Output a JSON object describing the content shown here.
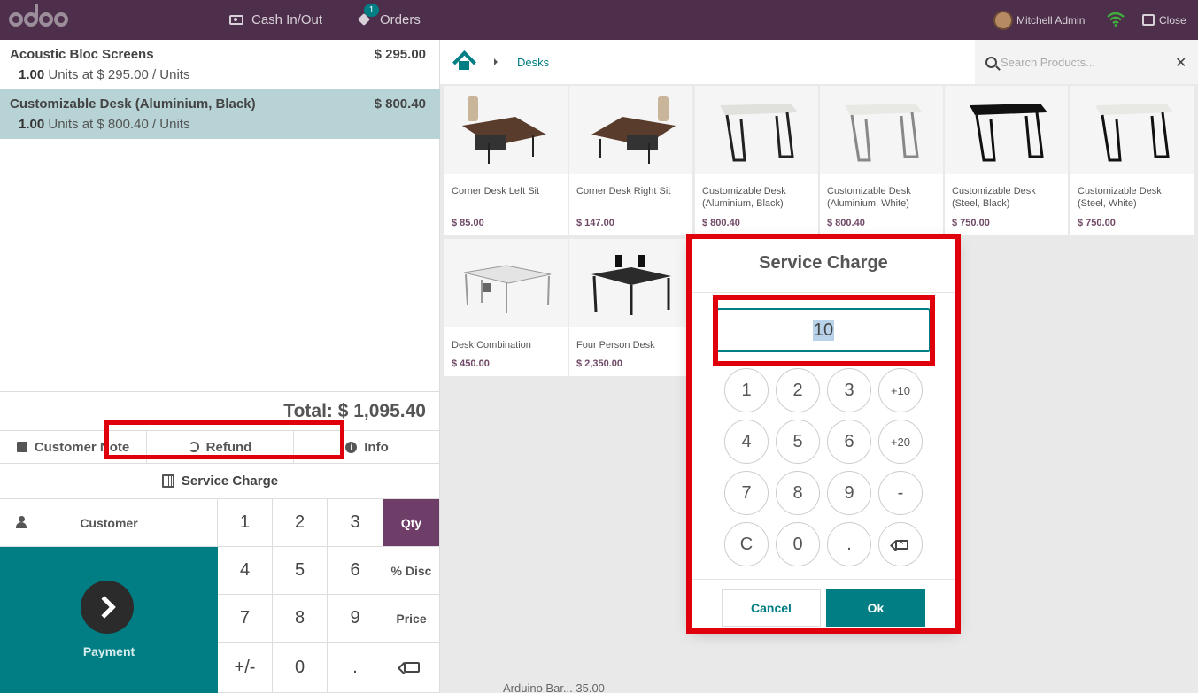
{
  "header": {
    "cash_label": "Cash In/Out",
    "orders_label": "Orders",
    "orders_badge": "1",
    "user_name": "Mitchell Admin",
    "close_label": "Close"
  },
  "order": {
    "lines": [
      {
        "name": "Acoustic Bloc Screens",
        "price": "$ 295.00",
        "qty": "1.00",
        "unit_text": "Units at $ 295.00 / Units"
      },
      {
        "name": "Customizable Desk (Aluminium, Black)",
        "price": "$ 800.40",
        "qty": "1.00",
        "unit_text": "Units at $ 800.40 / Units"
      }
    ],
    "total": "Total: $ 1,095.40"
  },
  "controls": {
    "customer_note": "Customer Note",
    "refund": "Refund",
    "info": "Info",
    "service_charge": "Service Charge"
  },
  "numpad": {
    "customer": "Customer",
    "payment": "Payment",
    "keys": [
      "1",
      "2",
      "3",
      "Qty",
      "4",
      "5",
      "6",
      "% Disc",
      "7",
      "8",
      "9",
      "Price",
      "+/-",
      "0",
      "."
    ]
  },
  "breadcrumb": {
    "category": "Desks"
  },
  "search": {
    "placeholder": "Search Products..."
  },
  "products": [
    {
      "name": "Corner Desk Left Sit",
      "price": "$ 85.00"
    },
    {
      "name": "Corner Desk Right Sit",
      "price": "$ 147.00"
    },
    {
      "name": "Customizable Desk (Aluminium, Black)",
      "price": "$ 800.40"
    },
    {
      "name": "Customizable Desk (Aluminium, White)",
      "price": "$ 800.40"
    },
    {
      "name": "Customizable Desk (Steel, Black)",
      "price": "$ 750.00"
    },
    {
      "name": "Customizable Desk (Steel, White)",
      "price": "$ 750.00"
    },
    {
      "name": "Desk Combination",
      "price": "$ 450.00"
    },
    {
      "name": "Four Person Desk",
      "price": "$ 2,350.00"
    }
  ],
  "modal": {
    "title": "Service Charge",
    "value": "10",
    "keys": [
      "1",
      "2",
      "3",
      "+10",
      "4",
      "5",
      "6",
      "+20",
      "7",
      "8",
      "9",
      "-",
      "C",
      "0",
      "."
    ],
    "cancel": "Cancel",
    "ok": "Ok"
  },
  "partial_item": "Arduino Bar... 35.00"
}
